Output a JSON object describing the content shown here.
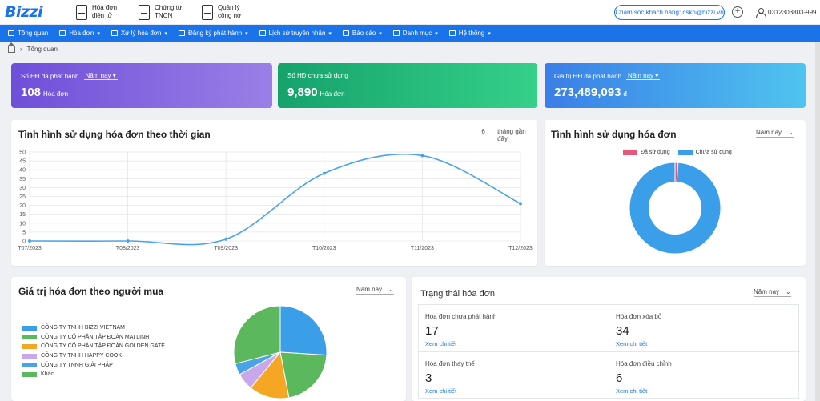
{
  "app": {
    "logo": "Bizzi",
    "cskh": "Chăm sóc khách hàng: cskh@bizzi.vn",
    "plus": "+",
    "tax_id": "0312303803-999"
  },
  "top_links": [
    {
      "line1": "Hóa đơn",
      "line2": "điện tử"
    },
    {
      "line1": "Chứng từ",
      "line2": "TNCN"
    },
    {
      "line1": "Quản lý",
      "line2": "công nợ"
    }
  ],
  "nav": [
    "Tổng quan",
    "Hóa đơn",
    "Xử lý hóa đơn",
    "Đăng ký phát hành",
    "Lịch sử truyền nhận",
    "Báo cáo",
    "Danh mục",
    "Hệ thống"
  ],
  "breadcrumb": "Tổng quan",
  "cards": [
    {
      "label": "Số HĐ đã phát hành",
      "select": "Năm nay",
      "value": "108",
      "unit": "Hóa đơn"
    },
    {
      "label": "Số HĐ chưa sử dụng",
      "value": "9,890",
      "unit": "Hóa đơn"
    },
    {
      "label": "Giá trị HĐ đã phát hành",
      "select": "Năm nay",
      "value": "273,489,093",
      "unit": "đ"
    }
  ],
  "usage_time": {
    "title": "Tình hình sử dụng hóa đơn theo thời gian",
    "months_value": "6",
    "months_suffix": "tháng gần đây."
  },
  "usage": {
    "title": "Tình hình sử dụng hóa đơn",
    "select": "Năm nay",
    "legend": [
      "Đã sử dụng",
      "Chưa sử dụng"
    ]
  },
  "buyer": {
    "title": "Giá trị hóa đơn theo người mua",
    "select": "Năm nay",
    "legend": [
      "CÔNG TY TNHH BIZZI VIETNAM",
      "CÔNG TY CỔ PHẦN TẬP ĐOÀN MAI LINH",
      "CÔNG TY CỔ PHẦN TẬP ĐOÀN GOLDEN GATE",
      "CÔNG TY TNHH HAPPY COOK",
      "CÔNG TY TNNH GIẢI PHÁP",
      "Khác"
    ]
  },
  "status": {
    "title": "Trạng thái hóa đơn",
    "select": "Năm nay",
    "cells": [
      {
        "label": "Hóa đơn chưa phát hành",
        "count": "17",
        "link": "Xem chi tiết"
      },
      {
        "label": "Hóa đơn xóa bỏ",
        "count": "34",
        "link": "Xem chi tiết"
      },
      {
        "label": "Hóa đơn thay thế",
        "count": "3",
        "link": "Xem chi tiết"
      },
      {
        "label": "Hóa đơn điều chỉnh",
        "count": "6",
        "link": "Xem chi tiết"
      }
    ]
  },
  "colors": {
    "primary": "#1a73e8",
    "card1": "#7b5be0",
    "card2": "#1fb47a",
    "card3": "#3a8ee8",
    "line": "#4aa3e8",
    "used": "#e8577a",
    "unused": "#3a9ee8"
  },
  "chart_data": [
    {
      "type": "line",
      "categories": [
        "T07/2023",
        "T08/2023",
        "T09/2023",
        "T10/2023",
        "T11/2023",
        "T12/2023"
      ],
      "values": [
        0,
        0,
        1,
        38,
        48,
        21
      ],
      "ylim": [
        0,
        50
      ],
      "yticks": [
        0,
        5,
        10,
        15,
        20,
        25,
        30,
        35,
        40,
        45,
        50
      ]
    },
    {
      "type": "pie",
      "subtype": "donut",
      "labels": [
        "Đã sử dụng",
        "Chưa sử dụng"
      ],
      "values": [
        108,
        9890
      ],
      "colors": [
        "#e8577a",
        "#3a9ee8"
      ]
    },
    {
      "type": "pie",
      "labels": [
        "CÔNG TY TNHH BIZZI VIETNAM",
        "CÔNG TY CỔ PHẦN TẬP ĐOÀN MAI LINH",
        "CÔNG TY CỔ PHẦN TẬP ĐOÀN GOLDEN GATE",
        "CÔNG TY TNHH HAPPY COOK",
        "CÔNG TY TNNH GIẢI PHÁP",
        "Khác"
      ],
      "values": [
        26,
        21,
        14,
        6,
        4,
        29
      ],
      "colors": [
        "#3a9ee8",
        "#5cb85c",
        "#f5a623",
        "#c8a8ea",
        "#4aa3e8",
        "#5cb85c"
      ]
    }
  ]
}
